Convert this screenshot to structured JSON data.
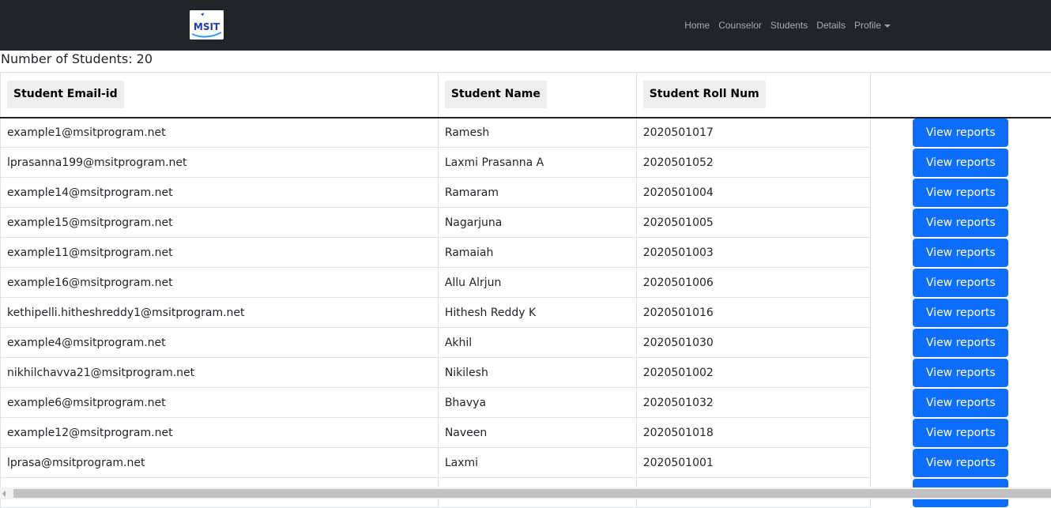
{
  "navbar": {
    "logo_text": "MSIT",
    "links": [
      "Home",
      "Counselor",
      "Students",
      "Details"
    ],
    "profile_label": "Profile"
  },
  "summary": {
    "count_label": "Number of Students: 20"
  },
  "table": {
    "headers": [
      "Student Email-id",
      "Student Name",
      "Student Roll Num"
    ],
    "action_label": "View reports",
    "rows": [
      {
        "email": "example1@msitprogram.net",
        "name": "Ramesh",
        "roll": "2020501017"
      },
      {
        "email": "lprasanna199@msitprogram.net",
        "name": "Laxmi Prasanna A",
        "roll": "2020501052"
      },
      {
        "email": "example14@msitprogram.net",
        "name": "Ramaram",
        "roll": "2020501004"
      },
      {
        "email": "example15@msitprogram.net",
        "name": "Nagarjuna",
        "roll": "2020501005"
      },
      {
        "email": "example11@msitprogram.net",
        "name": "Ramaiah",
        "roll": "2020501003"
      },
      {
        "email": "example16@msitprogram.net",
        "name": "Allu Alrjun",
        "roll": "2020501006"
      },
      {
        "email": "kethipelli.hitheshreddy1@msitprogram.net",
        "name": "Hithesh Reddy K",
        "roll": "2020501016"
      },
      {
        "email": "example4@msitprogram.net",
        "name": "Akhil",
        "roll": "2020501030"
      },
      {
        "email": "nikhilchavva21@msitprogram.net",
        "name": "Nikilesh",
        "roll": "2020501002"
      },
      {
        "email": "example6@msitprogram.net",
        "name": "Bhavya",
        "roll": "2020501032"
      },
      {
        "email": "example12@msitprogram.net",
        "name": "Naveen",
        "roll": "2020501018"
      },
      {
        "email": "lprasa@msitprogram.net",
        "name": "Laxmi",
        "roll": "2020501001"
      },
      {
        "email": "",
        "name": "",
        "roll": ""
      }
    ]
  },
  "colors": {
    "navbar_bg": "#212529",
    "button_bg": "#0d6efd",
    "header_chip_bg": "#eeeeee"
  },
  "icons": {
    "logo": "msit-logo-icon",
    "profile_caret": "caret-down-icon",
    "scroll_left": "scroll-left-arrow-icon"
  }
}
